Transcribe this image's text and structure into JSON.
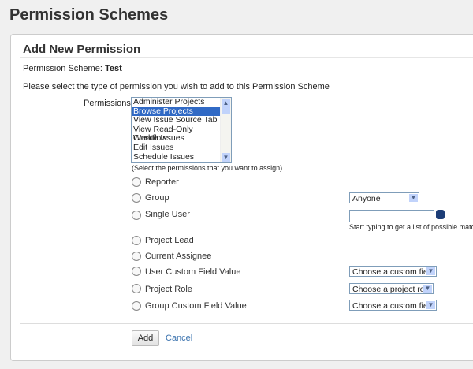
{
  "page_title": "Permission Schemes",
  "heading": "Add New Permission",
  "scheme_label": "Permission Scheme:",
  "scheme_name": "Test",
  "instructions": "Please select the type of permission you wish to add to this Permission Scheme",
  "permissions_label": "Permissions",
  "permissions": [
    "Administer Projects",
    "Browse Projects",
    "View Issue Source Tab",
    "View Read-Only Workflow",
    "Create Issues",
    "Edit Issues",
    "Schedule Issues"
  ],
  "permissions_hint": "(Select the permissions that you want to assign).",
  "options": {
    "reporter": "Reporter",
    "group": "Group",
    "single_user": "Single User",
    "project_lead": "Project Lead",
    "current_assignee": "Current Assignee",
    "user_cf": "User Custom Field Value",
    "project_role": "Project Role",
    "group_cf": "Group Custom Field Value"
  },
  "group_select": "Anyone",
  "user_hint": "Start typing to get a list of possible matches.",
  "user_cf_select": "Choose a custom field",
  "project_role_select": "Choose a project role",
  "group_cf_select": "Choose a custom field",
  "add_label": "Add",
  "cancel_label": "Cancel"
}
